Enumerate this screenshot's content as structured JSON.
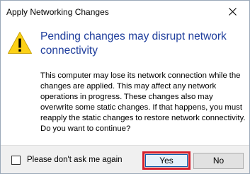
{
  "dialog": {
    "title": "Apply Networking Changes",
    "close_icon": "close-icon",
    "warning_icon": "warning-icon",
    "heading": "Pending changes may disrupt network connectivity",
    "message": "This computer may lose its network connection while the changes are applied. This may affect any network operations in progress. These changes also may overwrite some static changes. If that happens, you must reapply the static changes to restore network connectivity. Do you want to continue?",
    "checkbox": {
      "label": "Please don't ask me again",
      "checked": false
    },
    "buttons": {
      "yes": "Yes",
      "no": "No"
    }
  },
  "colors": {
    "heading": "#1e3d9c",
    "warning_fill": "#fcd116",
    "highlight_border": "#d61f2c",
    "footer_bg": "#f0f0f0"
  }
}
